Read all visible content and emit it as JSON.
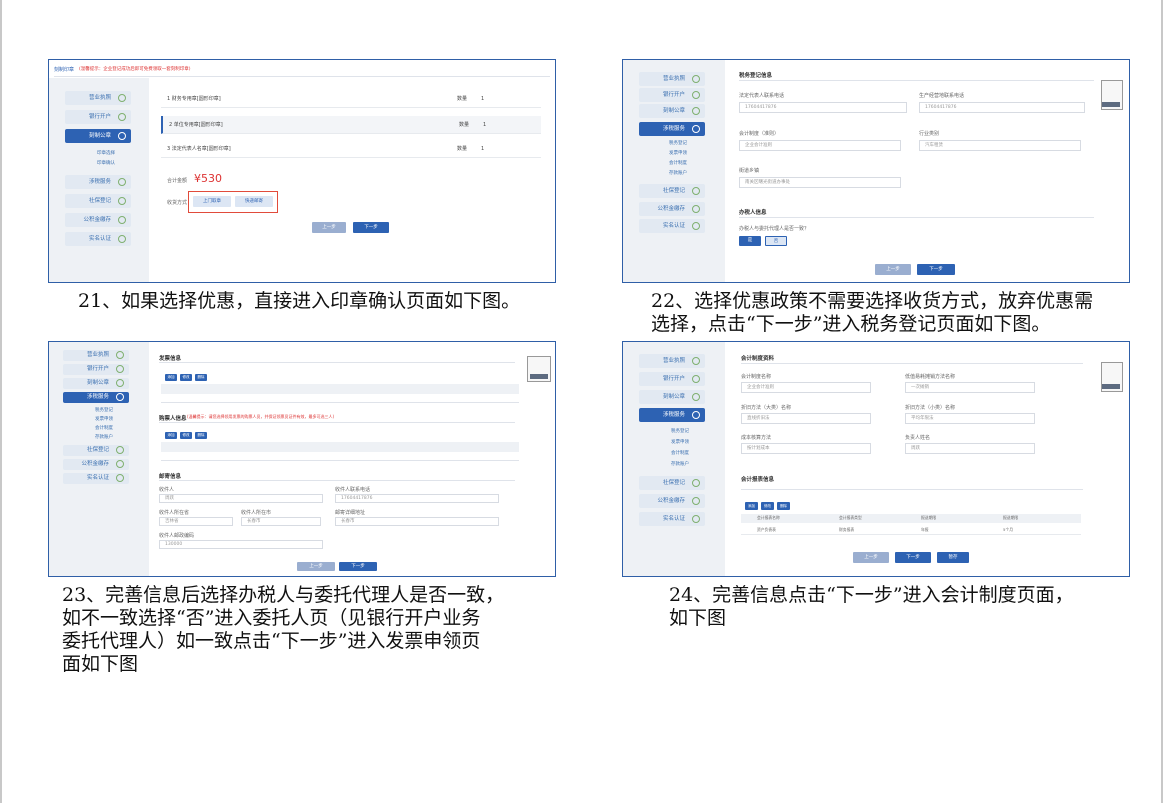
{
  "captions": {
    "c21": "21、如果选择优惠，直接进入印章确认页面如下图。",
    "c22_l1": "22、选择优惠政策不需要选择收货方式，放弃优惠需",
    "c22_l2": "选择，点击“下一步”进入税务登记页面如下图。",
    "c23_l1": "23、完善信息后选择办税人与委托代理人是否一致，",
    "c23_l2": "如不一致选择“否”进入委托人页（见银行开户业务",
    "c23_l3": "委托代理人）如一致点击“下一步”进入发票申领页",
    "c23_l4": "面如下图",
    "c24_l1": "24、完善信息点击“下一步”进入会计制度页面，",
    "c24_l2": "如下图"
  },
  "shot1": {
    "title": "刻制印章",
    "hint": "(温馨提示：企业登记成功后即可免费领取一套刻制印章)",
    "nav": [
      "营业执照",
      "银行开户",
      "刻制公章",
      "涉税服务",
      "社保登记",
      "公积金缴存",
      "实名认证"
    ],
    "sub": [
      "印章选择",
      "印章确认"
    ],
    "items": [
      "1 财务专用章[圆形印章]",
      "2 单位专用章[圆形印章]",
      "3 法定代表人名章[圆形印章]"
    ],
    "qty_label": "数量",
    "qty": "1",
    "total_label": "合计金额",
    "total": "¥530",
    "delivery_label": "收货方式",
    "delivery_options": [
      "上门取章",
      "快递邮寄"
    ],
    "prev": "上一步",
    "next": "下一步"
  },
  "shot2": {
    "section1": "税务登记信息",
    "phone1_label": "法定代表人联系电话",
    "phone1": "17604417876",
    "phone2_label": "生产经营地联系电话",
    "phone2": "17604417876",
    "acct_label": "会计制度（准则）",
    "acct": "企业会计准则",
    "industry_label": "行业类别",
    "industry": "汽车租赁",
    "street_label": "街道乡镇",
    "street": "南关区曙光街道办事处",
    "section2": "办税人信息",
    "question": "办税人与委托代理人是否一致？",
    "yes": "是",
    "no": "否",
    "nav": [
      "营业执照",
      "银行开户",
      "刻制公章",
      "涉税服务",
      "社保登记",
      "公积金缴存",
      "实名认证"
    ],
    "sub": [
      "税务登记",
      "发票申领",
      "会计制度",
      "存款账户"
    ],
    "prev": "上一步",
    "next": "下一步"
  },
  "shot3": {
    "section1": "发票信息",
    "section2": "购票人信息",
    "section2_hint": "(温馨提示：请您选择领用发票的购票人员，并保证领票员证件有效，最多可选三人)",
    "section3": "邮寄信息",
    "tools": [
      "添加",
      "修改",
      "删除"
    ],
    "recipient_label": "收件人",
    "recipient": "周跃",
    "recipient_phone_label": "收件人联系电话",
    "recipient_phone": "17604417876",
    "province_label": "收件人所在省",
    "province": "吉林省",
    "city_label": "收件人所在市",
    "city": "长春市",
    "addr_label": "邮寄详细地址",
    "addr": "长春市",
    "zip_label": "收件人邮政编码",
    "zip": "130000",
    "nav": [
      "营业执照",
      "银行开户",
      "刻制公章",
      "涉税服务",
      "社保登记",
      "公积金缴存",
      "实名认证"
    ],
    "sub": [
      "税务登记",
      "发票申领",
      "会计制度",
      "存款账户"
    ],
    "prev": "上一步",
    "next": "下一步"
  },
  "shot4": {
    "section1": "会计制度资料",
    "section2": "会计报表信息",
    "f1_label": "会计制度名称",
    "f1": "企业会计准则",
    "f2_label": "低值易耗摊销方法名称",
    "f2": "一次摊销",
    "f3_label": "折旧方法（大类）名称",
    "f3": "直线折旧法",
    "f4_label": "折旧方法（小类）名称",
    "f4": "平均年限法",
    "f5_label": "成本核算方法",
    "f5": "按计划成本",
    "f6_label": "负责人姓名",
    "f6": "周跃",
    "tools": [
      "添加",
      "修改",
      "删除"
    ],
    "cols": [
      "会计报表名称",
      "会计报表类型",
      "报送期限",
      "报送期限"
    ],
    "row": [
      "资产负债表",
      "财务报表",
      "年报",
      "5个月"
    ],
    "nav": [
      "营业执照",
      "银行开户",
      "刻制公章",
      "涉税服务",
      "社保登记",
      "公积金缴存",
      "实名认证"
    ],
    "sub": [
      "税务登记",
      "发票申领",
      "会计制度",
      "存款账户"
    ],
    "prev": "上一步",
    "next": "下一步",
    "save": "暂存"
  }
}
